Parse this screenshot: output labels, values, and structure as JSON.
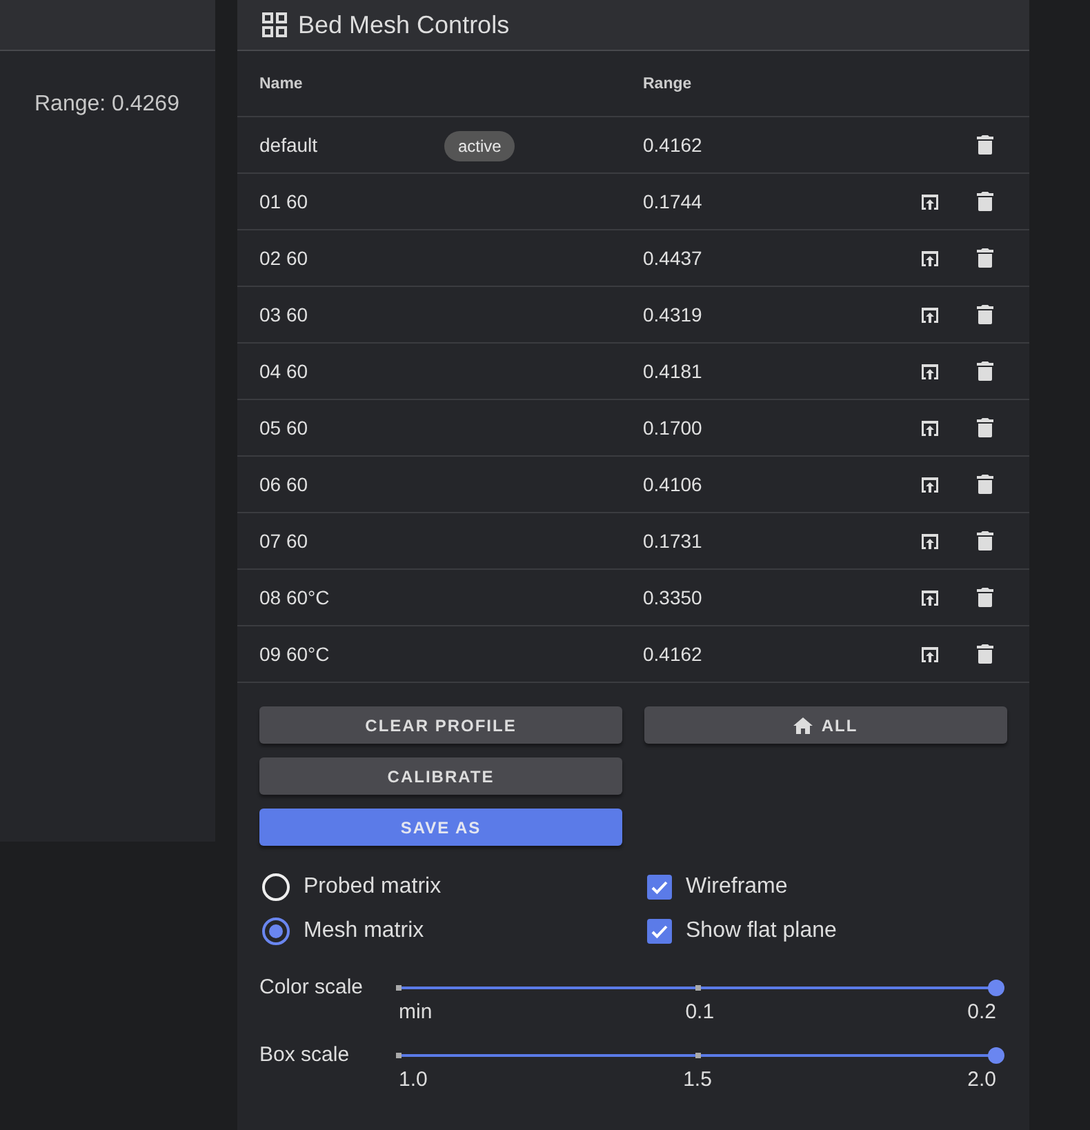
{
  "side_panel": {
    "text": "Range: 0.4269"
  },
  "card": {
    "title": "Bed Mesh Controls"
  },
  "table": {
    "columns": [
      "Name",
      "Range"
    ],
    "rows": [
      {
        "name": "default",
        "badge": "active",
        "range": "0.4162",
        "loadable": false
      },
      {
        "name": "01 60",
        "range": "0.1744",
        "loadable": true
      },
      {
        "name": "02 60",
        "range": "0.4437",
        "loadable": true
      },
      {
        "name": "03 60",
        "range": "0.4319",
        "loadable": true
      },
      {
        "name": "04 60",
        "range": "0.4181",
        "loadable": true
      },
      {
        "name": "05 60",
        "range": "0.1700",
        "loadable": true
      },
      {
        "name": "06 60",
        "range": "0.4106",
        "loadable": true
      },
      {
        "name": "07 60",
        "range": "0.1731",
        "loadable": true
      },
      {
        "name": "08 60°C",
        "range": "0.3350",
        "loadable": true
      },
      {
        "name": "09 60°C",
        "range": "0.4162",
        "loadable": true
      }
    ]
  },
  "action_columns": [
    [
      {
        "label": "CLEAR PROFILE",
        "kind": "default"
      },
      {
        "label": "CALIBRATE",
        "kind": "default"
      },
      {
        "label": "SAVE AS",
        "kind": "primary"
      }
    ],
    [
      {
        "label": "ALL",
        "kind": "home"
      }
    ]
  ],
  "view_modes": [
    {
      "label": "Probed matrix",
      "selected": false
    },
    {
      "label": "Mesh matrix",
      "selected": true
    }
  ],
  "options": [
    {
      "label": "Wireframe",
      "checked": true
    },
    {
      "label": "Show flat plane",
      "checked": true
    }
  ],
  "sliders": [
    {
      "label": "Color scale",
      "level": 1,
      "ticks": [
        "min",
        "0.1",
        "0.2"
      ]
    },
    {
      "label": "Box scale",
      "level": 1,
      "ticks": [
        "1.0",
        "1.5",
        "2.0"
      ]
    }
  ]
}
